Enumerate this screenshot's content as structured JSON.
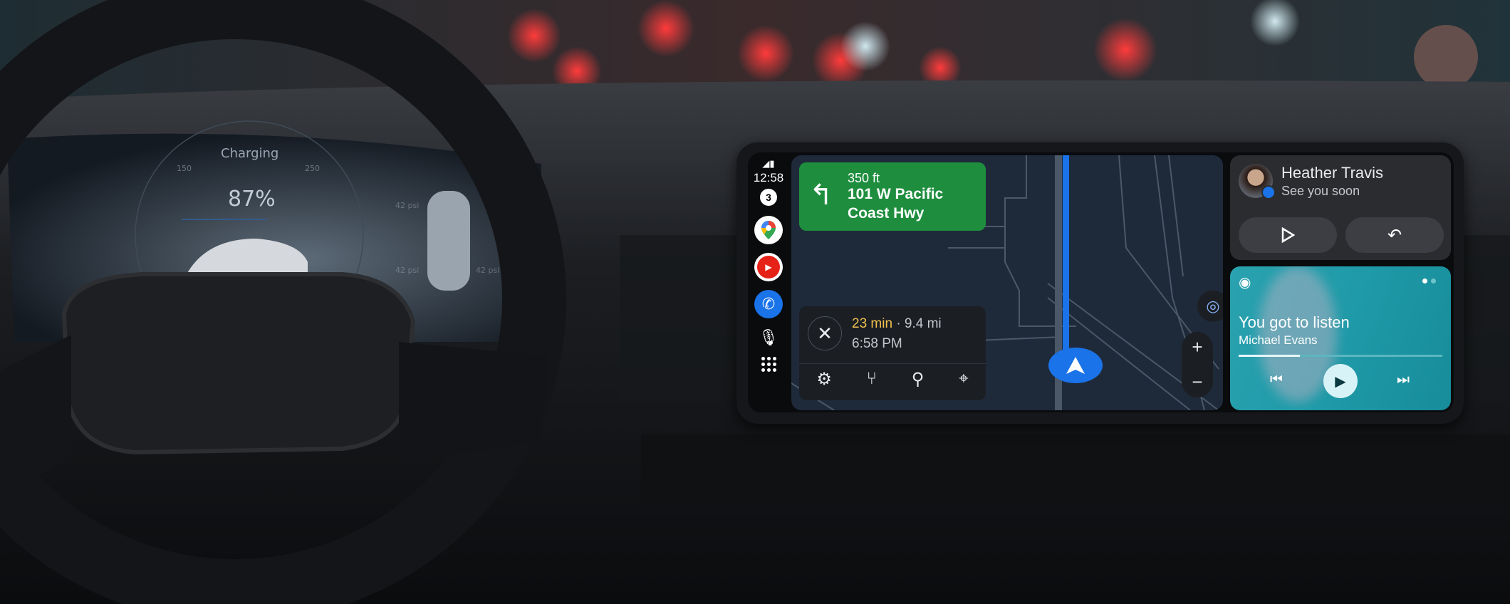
{
  "cluster": {
    "status": "Charging",
    "battery_percent": "87%",
    "battery_level": 0.87,
    "scale_left": "150",
    "scale_right": "250",
    "tire_pressures": [
      "42 psi",
      "42 psi",
      "42 psi"
    ]
  },
  "rail": {
    "time": "12:58",
    "notification_count": "3",
    "apps": [
      {
        "icon": "google-maps-icon"
      },
      {
        "icon": "youtube-music-icon"
      },
      {
        "icon": "phone-icon"
      }
    ],
    "mic_icon": "microphone-icon",
    "launcher_icon": "app-grid-icon"
  },
  "navigation": {
    "distance": "350 ft",
    "street_line1": "101 W Pacific",
    "street_line2": "Coast Hwy",
    "turn_icon": "turn-left-icon",
    "eta_duration": "23 min",
    "eta_distance": "· 9.4 mi",
    "arrival_time": "6:58 PM",
    "colors": {
      "maneuver": "#1e8e3e",
      "route": "#1a73e8",
      "duration": "#f2c14e"
    }
  },
  "message": {
    "sender": "Heather Travis",
    "preview": "See you soon"
  },
  "media": {
    "title": "You got to listen",
    "artist": "Michael Evans",
    "progress": 0.3,
    "page_count": 2,
    "active_page": 1
  }
}
